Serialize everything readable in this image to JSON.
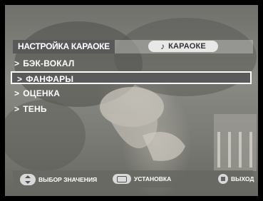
{
  "header": {
    "title": "НАСТРОЙКА КАРАОКЕ",
    "tab_label": "КАРАОКЕ",
    "tab_icon": "music-note-icon"
  },
  "menu": {
    "items": [
      {
        "label": "БЭК-ВОКАЛ",
        "selected": false
      },
      {
        "label": "ФАНФАРЫ",
        "selected": true
      },
      {
        "label": "ОЦЕНКА",
        "selected": false
      },
      {
        "label": "ТЕНЬ",
        "selected": false
      }
    ],
    "arrow": ">"
  },
  "footer": {
    "select_label": "ВЫБОР ЗНАЧЕНИЯ",
    "set_label": "УСТАНОВКА",
    "exit_label": "ВЫХОД"
  }
}
